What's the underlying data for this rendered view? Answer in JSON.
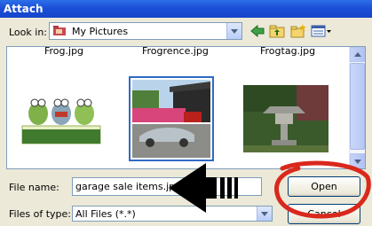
{
  "window": {
    "title": "Attach"
  },
  "toolbar": {
    "look_in_label": "Look in:",
    "look_in_value": "My Pictures",
    "icons": [
      "back-arrow-icon",
      "up-folder-icon",
      "new-folder-icon",
      "views-menu-icon"
    ]
  },
  "files": [
    {
      "name": "Frog.jpg",
      "thumbnail": "frogs-figurines-icon"
    },
    {
      "name": "Frogrence.jpg",
      "thumbnail": "garage-sports-car-photo",
      "selected": true
    },
    {
      "name": "Frogtag.jpg",
      "thumbnail": "garden-stone-lantern-photo"
    }
  ],
  "form": {
    "file_name_label": "File name:",
    "file_name_value": "garage sale items.jpg",
    "files_of_type_label": "Files of type:",
    "files_of_type_value": "All Files (*.*)"
  },
  "buttons": {
    "open": "Open",
    "cancel": "Cancel"
  },
  "colors": {
    "title_bar": "#1b50d8",
    "selection_border": "#316ac5",
    "annotation_red": "#d9281c",
    "annotation_arrow": "#000000"
  }
}
